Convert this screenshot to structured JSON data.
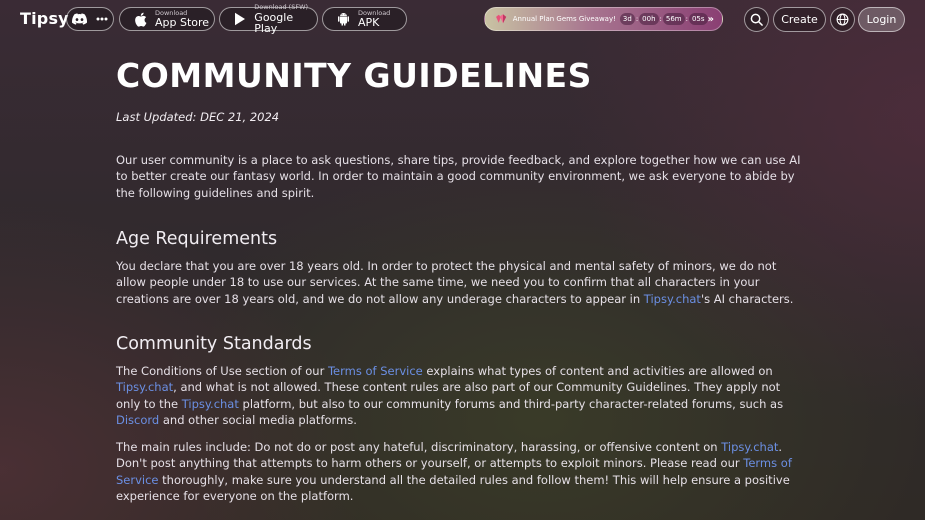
{
  "header": {
    "logo": "Tipsy",
    "icons": {
      "discord": "discord-icon",
      "more": "more-icon",
      "search": "search-icon",
      "globe": "globe-icon"
    },
    "downloads": [
      {
        "small": "Download",
        "big": "App Store",
        "icon": "apple-icon"
      },
      {
        "small": "Download (SFW)",
        "big": "Google Play",
        "icon": "google-play-icon"
      },
      {
        "small": "Download",
        "big": "APK",
        "icon": "android-icon"
      }
    ],
    "promo": {
      "text": "Annual Plan Gems Giveaway!",
      "days": "3d",
      "hours": "00h",
      "minutes": "56m",
      "seconds": "05s",
      "arrow": "»"
    },
    "create_label": "Create",
    "login_label": "Login"
  },
  "page": {
    "title": "COMMUNITY GUIDELINES",
    "last_updated": "Last Updated: DEC 21, 2024",
    "intro": "Our user community is a place to ask questions, share tips, provide feedback, and explore together how we can use AI to better create our fantasy world. In order to maintain a good community environment, we ask everyone to abide by the following guidelines and spirit.",
    "age": {
      "heading": "Age Requirements",
      "text_1": "You declare that you are over 18 years old. In order to protect the physical and mental safety of minors, we do not allow people under 18 to use our services. At the same time, we need you to confirm that all characters in your creations are over 18 years old, and we do not allow any underage characters to appear in ",
      "link_1": "Tipsy.chat",
      "text_2": "'s AI characters."
    },
    "standards": {
      "heading": "Community Standards",
      "p1_a": "The Conditions of Use section of our ",
      "p1_link_tos": "Terms of Service",
      "p1_b": " explains what types of content and activities are allowed on ",
      "p1_link_site1": "Tipsy.chat",
      "p1_c": ", and what is not allowed. These content rules are also part of our Community Guidelines. They apply not only to the ",
      "p1_link_site2": "Tipsy.chat",
      "p1_d": " platform, but also to our community forums and third-party character-related forums, such as ",
      "p1_link_discord": "Discord",
      "p1_e": " and other social media platforms.",
      "p2_a": "The main rules include: Do not do or post any hateful, discriminatory, harassing, or offensive content on ",
      "p2_link_site": "Tipsy.chat",
      "p2_b": ". Don't post anything that attempts to harm others or yourself, or attempts to exploit minors. Please read our ",
      "p2_link_tos": "Terms of Service",
      "p2_c": " thoroughly, make sure you understand all the detailed rules and follow them! This will help ensure a positive experience for everyone on the platform."
    }
  },
  "colors": {
    "link": "#6b8fe3",
    "promo_start": "#c9c3a3",
    "promo_end": "#8a3f73"
  }
}
